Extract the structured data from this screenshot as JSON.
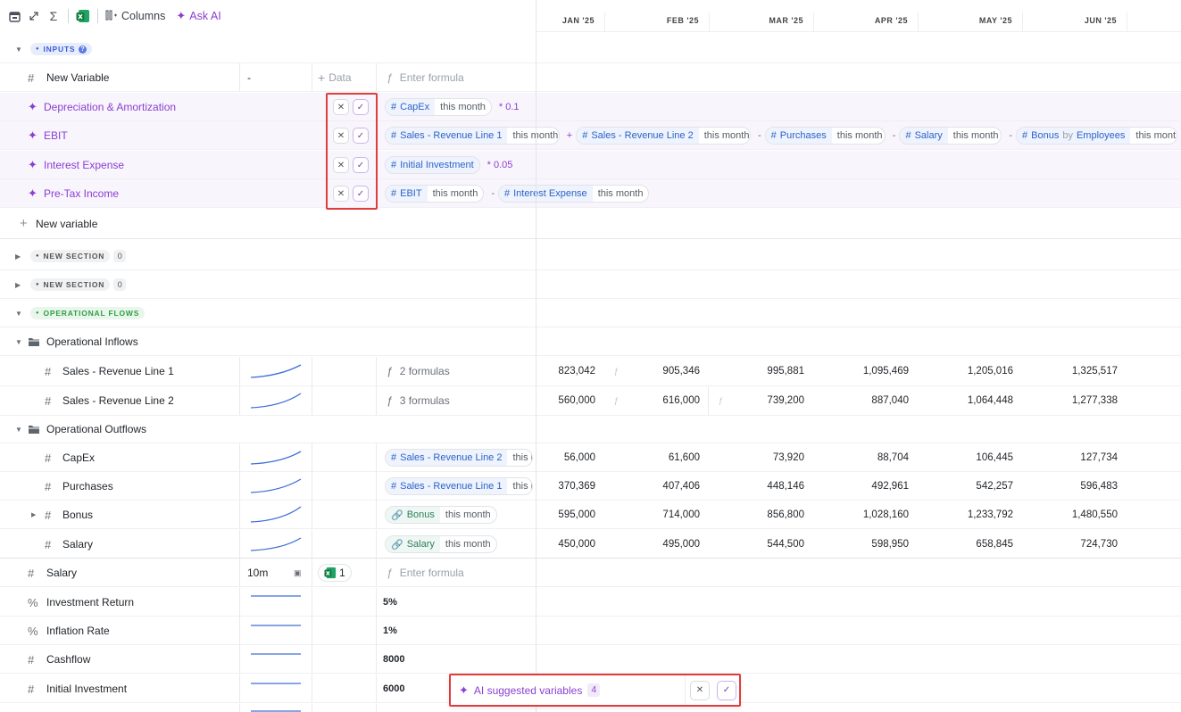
{
  "toolbar": {
    "columns_label": "Columns",
    "ask_ai_label": "Ask AI",
    "icons": [
      "calendar-icon",
      "expand-icon",
      "sigma-icon",
      "excel-icon",
      "columns-icon",
      "sparkle-icon"
    ]
  },
  "months": [
    "JAN '25",
    "FEB '25",
    "MAR '25",
    "APR '25",
    "MAY '25",
    "JUN '25"
  ],
  "sections": {
    "inputs": {
      "label": "INPUTS",
      "color": "#3b5bdb"
    },
    "new_section_1": {
      "label": "NEW SECTION",
      "count": "0"
    },
    "new_section_2": {
      "label": "NEW SECTION",
      "count": "0"
    },
    "operational_flows": {
      "label": "OPERATIONAL FLOWS",
      "color": "#2f9e44"
    }
  },
  "new_variable_row": {
    "name": "New Variable",
    "value": "-",
    "data_label": "Data",
    "formula_placeholder": "Enter formula"
  },
  "ai_rows": [
    {
      "name": "Depreciation & Amortization",
      "chips": [
        {
          "ref": "CapEx",
          "qual": "this month"
        }
      ],
      "suffix": "* 0.1"
    },
    {
      "name": "EBIT",
      "chips": [
        {
          "ref": "Sales - Revenue Line 1",
          "qual": "this month"
        },
        {
          "op": "+"
        },
        {
          "ref": "Sales - Revenue Line 2",
          "qual": "this month"
        },
        {
          "op": "-"
        },
        {
          "ref": "Purchases",
          "qual": "this month"
        },
        {
          "op": "-"
        },
        {
          "ref": "Salary",
          "qual": "this month"
        },
        {
          "op": "-"
        },
        {
          "ref": "Bonus",
          "by": "by",
          "ref2": "Employees",
          "qual": "this mont"
        }
      ]
    },
    {
      "name": "Interest Expense",
      "chips": [
        {
          "ref": "Initial Investment"
        }
      ],
      "suffix": "* 0.05"
    },
    {
      "name": "Pre-Tax Income",
      "chips": [
        {
          "ref": "EBIT",
          "qual": "this month"
        },
        {
          "op": "-"
        },
        {
          "ref": "Interest Expense",
          "qual": "this month"
        }
      ]
    }
  ],
  "new_variable_link": "New variable",
  "groups": {
    "inflows": "Operational Inflows",
    "outflows": "Operational Outflows"
  },
  "inflow_rows": [
    {
      "name": "Sales - Revenue Line 1",
      "formula": "2 formulas",
      "values": [
        "823,042",
        "905,346",
        "995,881",
        "1,095,469",
        "1,205,016",
        "1,325,517"
      ]
    },
    {
      "name": "Sales - Revenue Line 2",
      "formula": "3 formulas",
      "values": [
        "560,000",
        "616,000",
        "739,200",
        "887,040",
        "1,064,448",
        "1,277,338"
      ]
    }
  ],
  "outflow_rows": [
    {
      "name": "CapEx",
      "chip_ref": "Sales - Revenue Line 2",
      "chip_qual": "this m",
      "values": [
        "56,000",
        "61,600",
        "73,920",
        "88,704",
        "106,445",
        "127,734"
      ]
    },
    {
      "name": "Purchases",
      "chip_ref": "Sales - Revenue Line 1",
      "chip_qual": "this m",
      "values": [
        "370,369",
        "407,406",
        "448,146",
        "492,961",
        "542,257",
        "596,483"
      ]
    },
    {
      "name": "Bonus",
      "chip_ref": "Bonus",
      "chip_qual": "this month",
      "values": [
        "595,000",
        "714,000",
        "856,800",
        "1,028,160",
        "1,233,792",
        "1,480,550"
      ]
    },
    {
      "name": "Salary",
      "chip_ref": "Salary",
      "chip_qual": "this month",
      "values": [
        "450,000",
        "495,000",
        "544,500",
        "598,950",
        "658,845",
        "724,730"
      ]
    }
  ],
  "salary_row": {
    "name": "Salary",
    "value": "10m",
    "excel_count": "1",
    "formula_placeholder": "Enter formula"
  },
  "bottom_rows": [
    {
      "name": "Investment Return",
      "icon": "percent-icon",
      "value": "5%"
    },
    {
      "name": "Inflation Rate",
      "icon": "percent-icon",
      "value": "1%"
    },
    {
      "name": "Cashflow",
      "icon": "hash-icon",
      "value": "8000"
    },
    {
      "name": "Initial Investment",
      "icon": "hash-icon",
      "value": "6000"
    }
  ],
  "ai_banner": {
    "label": "AI suggested variables",
    "count": "4"
  },
  "colors": {
    "ai_purple": "#8b3fd1",
    "chip_blue": "#2d63c8",
    "highlight_red": "#e03c3c"
  }
}
